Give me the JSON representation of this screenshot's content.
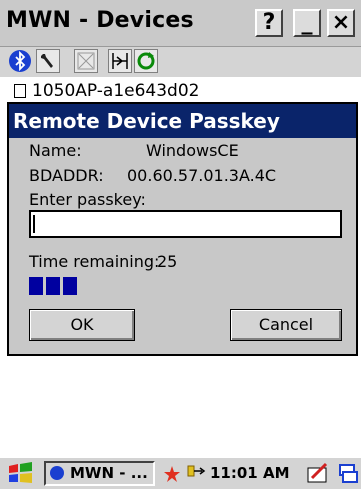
{
  "window": {
    "title": "MWN - Devices"
  },
  "titlebar_buttons": {
    "help": "?",
    "minimize": "_",
    "close": "×"
  },
  "toolbar": {
    "icons": [
      "bluetooth-icon",
      "wrench-icon",
      "disabled-icon",
      "connect-icon",
      "refresh-icon"
    ]
  },
  "device_list": {
    "item": "1050AP-a1e643d02"
  },
  "dialog": {
    "title": "Remote Device Passkey",
    "name_label": "Name:",
    "name_value": "WindowsCE",
    "bdaddr_label": "BDADDR:",
    "bdaddr_value": "00.60.57.01.3A.4C",
    "passkey_label": "Enter passkey:",
    "passkey_value": "",
    "time_label": "Time remaining:",
    "time_value": "25",
    "progress_blocks": 3,
    "ok_label": "OK",
    "cancel_label": "Cancel"
  },
  "taskbar": {
    "task_label": "MWN - ...",
    "clock": "11:01 AM"
  },
  "colors": {
    "dialog_title_bg": "#0a246a",
    "progress": "#0000a0"
  }
}
